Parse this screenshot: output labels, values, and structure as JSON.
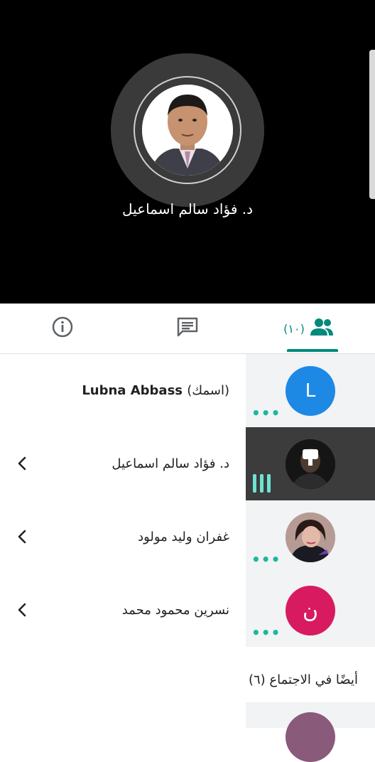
{
  "stage": {
    "speaker_name": "د. فؤاد سالم اسماعيل"
  },
  "tabs": {
    "info_icon": "info-icon",
    "chat_icon": "chat-icon",
    "people_icon": "people-icon",
    "people_count": "(١٠)",
    "accent": "#00897b"
  },
  "participants": [
    {
      "name": "Lubna Abbass",
      "suffix": "(اسمك)",
      "initial": "L",
      "avatar_color": "#1e88e5",
      "status": "more-dots"
    },
    {
      "name": "د. فؤاد سالم اسماعيل",
      "status": "speaking-bars",
      "active": true
    },
    {
      "name": "غفران وليد مولود",
      "status": "more-dots"
    },
    {
      "name": "نسرين محمود محمد",
      "initial": "ن",
      "avatar_color": "#d81b60",
      "status": "more-dots"
    }
  ],
  "section": {
    "also_in_meeting": "أيضًا في الاجتماع (٦)"
  }
}
